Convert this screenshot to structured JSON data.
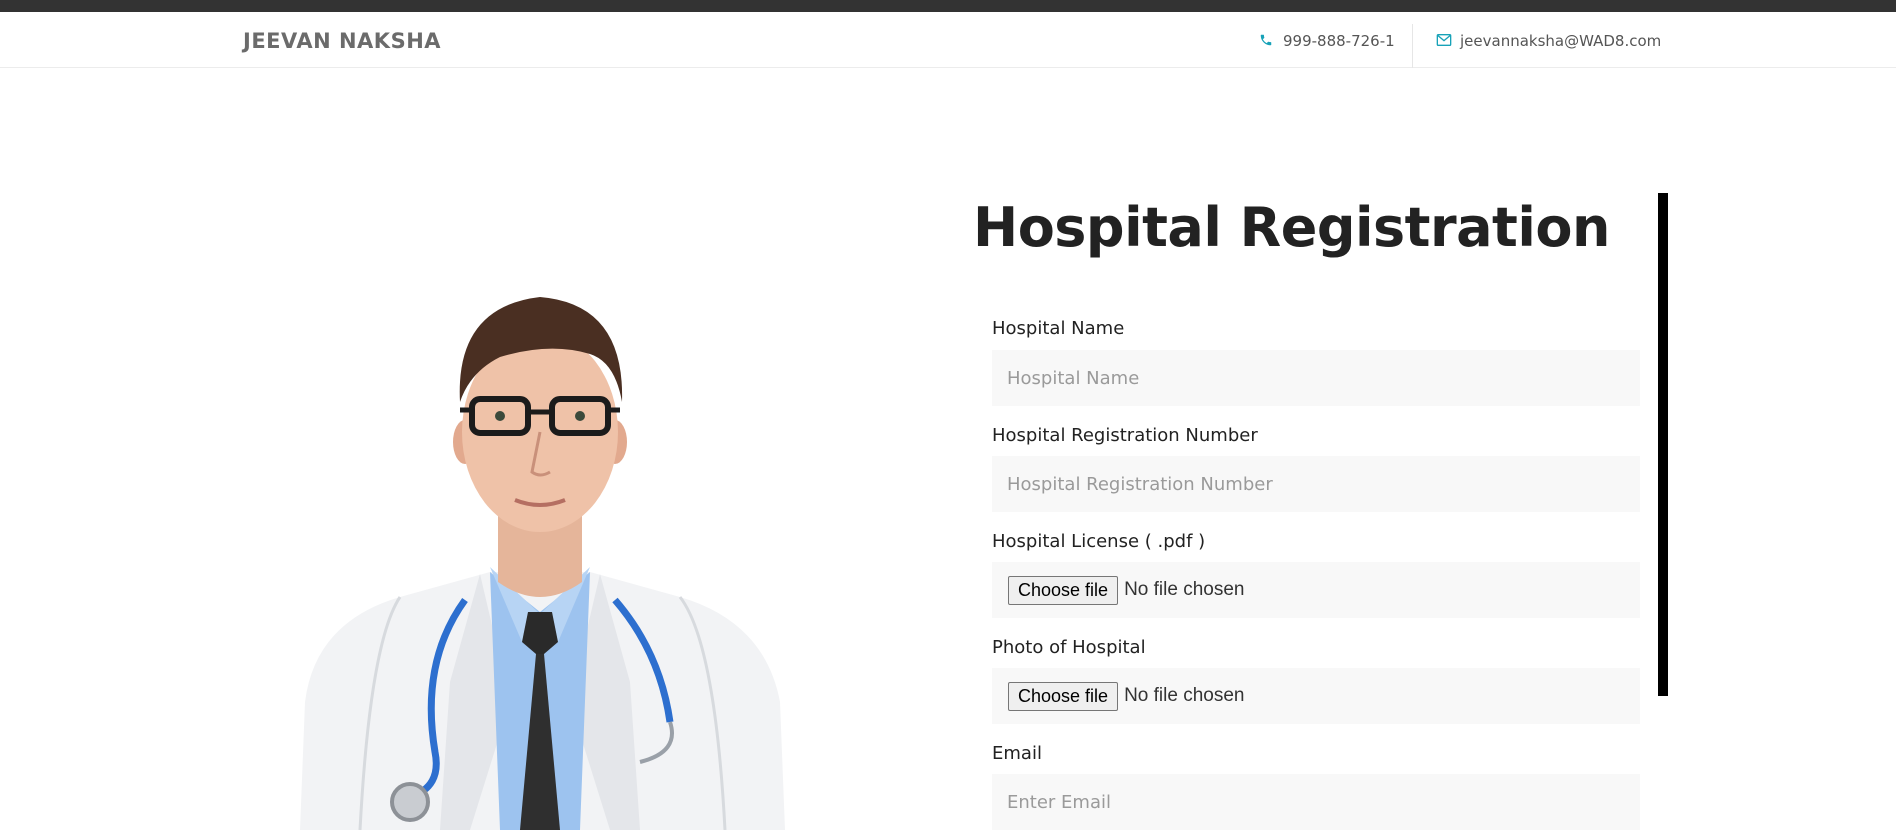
{
  "header": {
    "brand": "JEEVAN NAKSHA",
    "phone": "999-888-726-1",
    "email": "jeevannaksha@WAD8.com",
    "phone_icon": "phone-icon",
    "email_icon": "envelope-icon",
    "accent_color": "#17a2b8"
  },
  "form": {
    "title": "Hospital Registration",
    "fields": [
      {
        "label": "Hospital Name",
        "placeholder": "Hospital Name"
      },
      {
        "label": "Hospital Registration Number",
        "placeholder": "Hospital Registration Number"
      },
      {
        "label": "Hospital License ( .pdf )",
        "button": "Choose file",
        "status": "No file chosen"
      },
      {
        "label": "Photo of Hospital",
        "button": "Choose file",
        "status": "No file chosen"
      },
      {
        "label": "Email",
        "placeholder": "Enter Email"
      }
    ]
  }
}
